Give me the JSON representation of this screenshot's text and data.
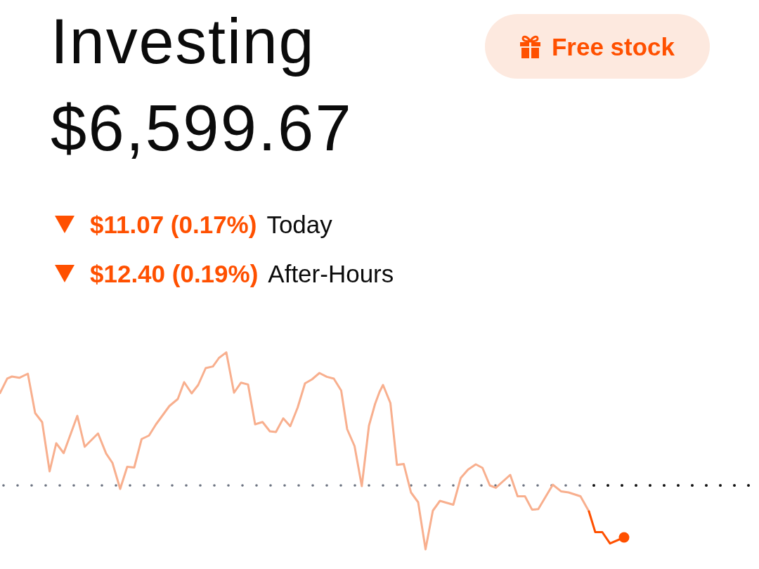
{
  "header": {
    "title": "Investing",
    "free_stock_button": {
      "label": "Free stock"
    }
  },
  "portfolio_value": "$6,599.67",
  "changes": [
    {
      "kind": "down",
      "amount": "$11.07 (0.17%)",
      "period": "Today"
    },
    {
      "kind": "down",
      "amount": "$12.40 (0.19%)",
      "period": "After-Hours"
    }
  ]
}
